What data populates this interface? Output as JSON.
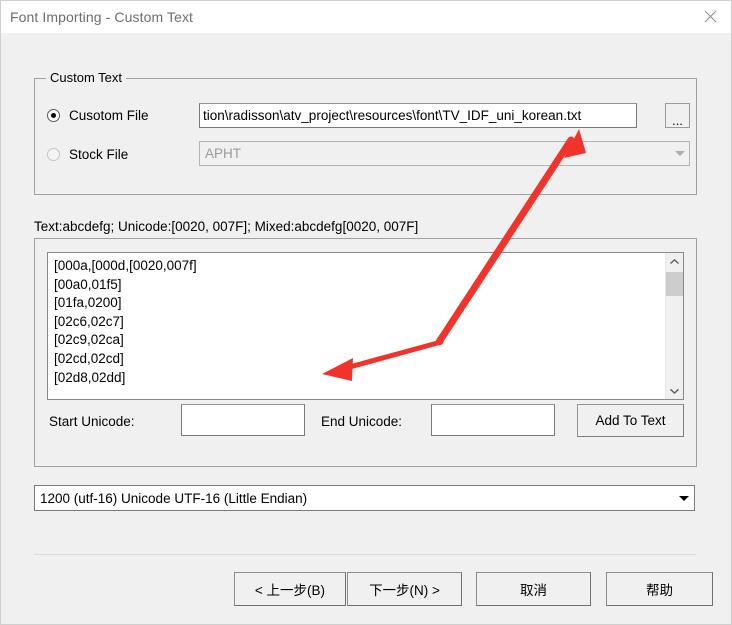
{
  "window": {
    "title": "Font Importing - Custom Text",
    "close_icon": "close-icon"
  },
  "custom_text_group": {
    "legend": "Custom Text",
    "custom_file": {
      "radio_label": "Cusotom File",
      "checked": true,
      "path_value": "tion\\radisson\\atv_project\\resources\\font\\TV_IDF_uni_korean.txt",
      "browse_label": "..."
    },
    "stock_file": {
      "radio_label": "Stock File",
      "checked": false,
      "combo_value": "APHT",
      "enabled": false
    }
  },
  "hint": "Text:abcdefg;  Unicode:[0020, 007F];  Mixed:abcdefg[0020, 007F]",
  "text_entry_group": {
    "lines": [
      "[000a,[000d,[0020,007f]",
      "[00a0,01f5]",
      "[01fa,0200]",
      "[02c6,02c7]",
      "[02c9,02ca]",
      "[02cd,02cd]",
      "[02d8,02dd]"
    ],
    "scrollbar": {
      "up_icon": "chevron-up-icon",
      "down_icon": "chevron-down-icon"
    },
    "start_unicode": {
      "label": "Start Unicode:",
      "value": "",
      "placeholder": ""
    },
    "end_unicode": {
      "label": "End Unicode:",
      "value": "",
      "placeholder": ""
    },
    "add_to_text_label": "Add To Text"
  },
  "encoding": {
    "value": "1200    (utf-16)    Unicode UTF-16 (Little Endian)",
    "arrow_icon": "chevron-down-icon"
  },
  "footer": {
    "back_label": "< 上一步(B)",
    "next_label": "下一步(N) >",
    "cancel_label": "取消",
    "help_label": "帮助"
  },
  "annotations": {
    "arrow_color": "#f0342c",
    "arrow_up_right_target": "file-path-field",
    "arrow_down_left_target": "text-entry-listbox"
  }
}
